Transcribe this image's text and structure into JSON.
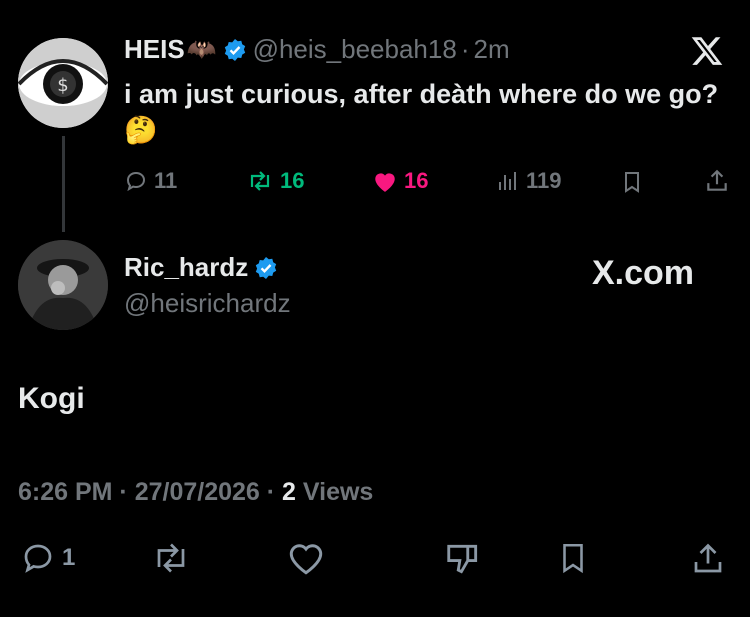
{
  "quoted_tweet": {
    "author_name": "HEIS",
    "name_emoji": "🦇",
    "author_handle": "@heis_beebah18",
    "separator": "·",
    "time_ago": "2m",
    "text": "i am just curious, after deàth where do we go?🤔",
    "stats": {
      "replies": "11",
      "reposts": "16",
      "likes": "16",
      "views": "119"
    },
    "colors": {
      "repost": "#00ba7c",
      "like": "#f91880"
    }
  },
  "reply": {
    "author_name": "Ric_hardz",
    "author_handle": "@heisrichardz",
    "watermark": "X.com",
    "text": "Kogi",
    "timestamp": "6:26 PM · 27/07/2026 · ",
    "views_count": "2",
    "views_label": "Views",
    "actions": {
      "replies": "1"
    }
  },
  "brand": {
    "logo": "x-logo-icon",
    "verified_color": "#1d9bf0"
  }
}
